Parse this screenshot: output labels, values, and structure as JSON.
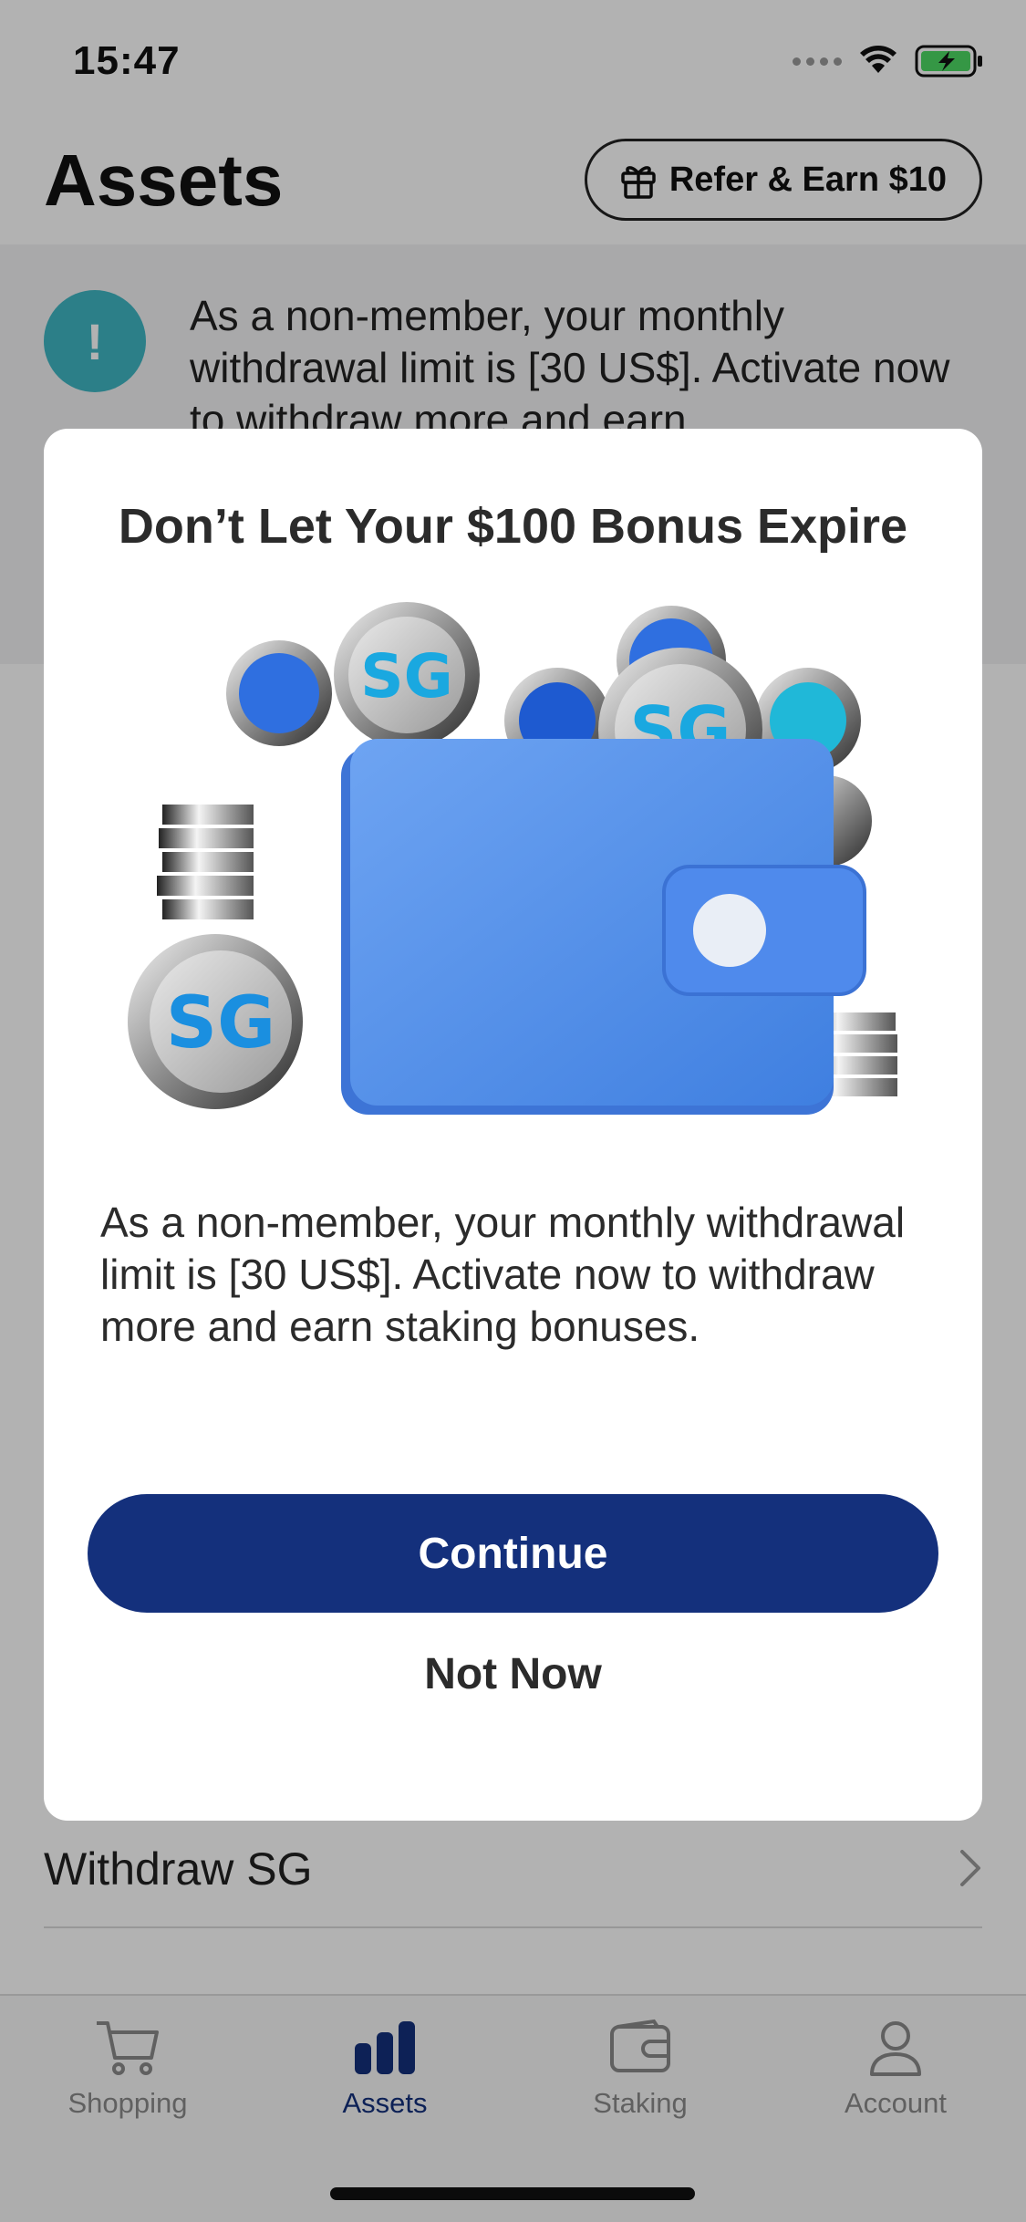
{
  "status_bar": {
    "time": "15:47"
  },
  "header": {
    "title": "Assets",
    "refer_button": "Refer & Earn $10"
  },
  "notice": {
    "icon": "exclamation-icon",
    "text": "As a non-member, your monthly withdrawal limit is [30 US$]. Activate now to withdraw more and earn"
  },
  "menu": {
    "withdraw_label": "Withdraw SG"
  },
  "modal": {
    "title": "Don’t Let Your $100 Bonus Expire",
    "body": "As a non-member, your monthly withdrawal limit is [30 US$]. Activate now to withdraw more and earn staking bonuses.",
    "continue_label": "Continue",
    "not_now_label": "Not Now",
    "coin_mark": "SG"
  },
  "tab_bar": {
    "tabs": [
      {
        "label": "Shopping",
        "icon": "cart-icon",
        "active": false
      },
      {
        "label": "Assets",
        "icon": "bar-chart-icon",
        "active": true
      },
      {
        "label": "Staking",
        "icon": "wallet-icon",
        "active": false
      },
      {
        "label": "Account",
        "icon": "person-icon",
        "active": false
      }
    ]
  },
  "colors": {
    "primary": "#14307c",
    "notice_icon": "#3fb7c3",
    "wallet": "#5b93ea",
    "battery": "#4cd964"
  }
}
